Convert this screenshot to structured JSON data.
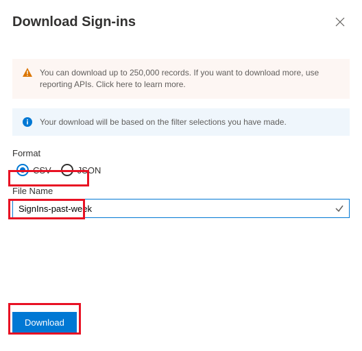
{
  "header": {
    "title": "Download Sign-ins"
  },
  "banners": {
    "warning": "You can download up to 250,000 records. If you want to download more, use reporting APIs. Click here to learn more.",
    "info": "Your download will be based on the filter selections you have made."
  },
  "format": {
    "label": "Format",
    "options": {
      "csv": "CSV",
      "json": "JSON"
    },
    "selected": "csv"
  },
  "fileName": {
    "label": "File Name",
    "value": "SignIns-past-week"
  },
  "actions": {
    "download": "Download"
  }
}
